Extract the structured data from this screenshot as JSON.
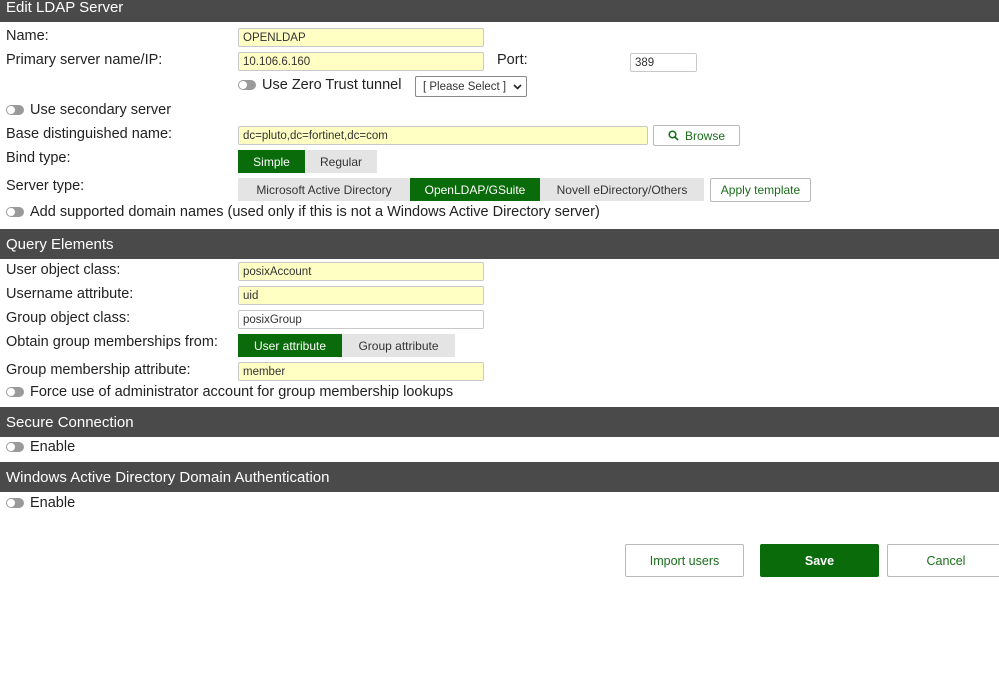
{
  "sections": {
    "edit": "Edit LDAP Server",
    "query": "Query Elements",
    "secure": "Secure Connection",
    "windows": "Windows Active Directory Domain Authentication"
  },
  "fields": {
    "name": {
      "label": "Name:",
      "value": "OPENLDAP"
    },
    "primary": {
      "label": "Primary server name/IP:",
      "value": "10.106.6.160"
    },
    "port": {
      "label": "Port:",
      "value": "389"
    },
    "zero_trust": {
      "label": "Use Zero Trust tunnel",
      "select_value": "[ Please Select ]"
    },
    "secondary": {
      "label": "Use secondary server"
    },
    "base_dn": {
      "label": "Base distinguished name:",
      "value": "dc=pluto,dc=fortinet,dc=com",
      "browse": "Browse"
    },
    "bind_type": {
      "label": "Bind type:",
      "options": [
        "Simple",
        "Regular"
      ],
      "selected": "Simple"
    },
    "server_type": {
      "label": "Server type:",
      "options": [
        "Microsoft Active Directory",
        "OpenLDAP/GSuite",
        "Novell eDirectory/Others"
      ],
      "selected": "OpenLDAP/GSuite",
      "apply": "Apply template"
    },
    "domain_names": {
      "label": "Add supported domain names (used only if this is not a Windows Active Directory server)"
    }
  },
  "query": {
    "user_object_class": {
      "label": "User object class:",
      "value": "posixAccount"
    },
    "username_attribute": {
      "label": "Username attribute:",
      "value": "uid"
    },
    "group_object_class": {
      "label": "Group object class:",
      "value": "posixGroup"
    },
    "obtain_group": {
      "label": "Obtain group memberships from:",
      "options": [
        "User attribute",
        "Group attribute"
      ],
      "selected": "User attribute"
    },
    "group_membership_attr": {
      "label": "Group membership attribute:",
      "value": "member"
    },
    "force_admin": {
      "label": "Force use of administrator account for group membership lookups"
    }
  },
  "secure": {
    "enable": "Enable"
  },
  "windows": {
    "enable": "Enable"
  },
  "buttons": {
    "import": "Import users",
    "save": "Save",
    "cancel": "Cancel"
  },
  "colors": {
    "header_bg": "#4a4a4a",
    "accent_green": "#0a6b0a",
    "input_yellow": "#ffffc4"
  }
}
